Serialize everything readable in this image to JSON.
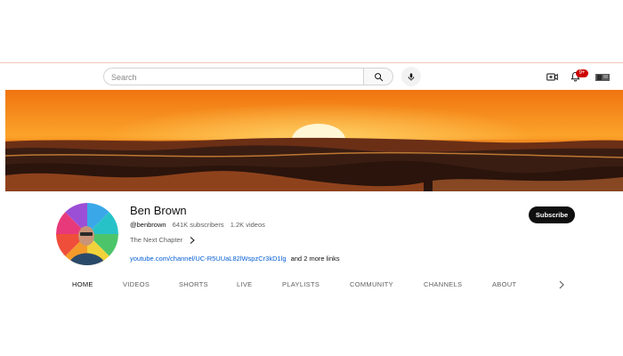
{
  "header": {
    "search": {
      "placeholder": "Search",
      "value": ""
    },
    "icons": {
      "search": "search-icon",
      "mic": "mic-icon",
      "create": "create-video-icon",
      "notifications": "bell-icon",
      "account": "account-avatar"
    },
    "notification_badge": "9+"
  },
  "banner": {
    "subject": "sunset-over-clouds",
    "colors": {
      "sky_top": "#f47a12",
      "sky_mid": "#fba52a",
      "sun": "#fff6d5",
      "clouds": "#3a1d12"
    }
  },
  "channel": {
    "name": "Ben Brown",
    "handle": "@benbrown",
    "subscribers": "641K subscribers",
    "videos": "1.2K videos",
    "description": "The Next Chapter",
    "link": "youtube.com/channel/UC-R5UUaL82lWspzCr3kD1lg",
    "more_links": "and 2 more links",
    "subscribe_label": "Subscribe"
  },
  "tabs": [
    {
      "label": "HOME",
      "active": true
    },
    {
      "label": "VIDEOS",
      "active": false
    },
    {
      "label": "SHORTS",
      "active": false
    },
    {
      "label": "LIVE",
      "active": false
    },
    {
      "label": "PLAYLISTS",
      "active": false
    },
    {
      "label": "COMMUNITY",
      "active": false
    },
    {
      "label": "CHANNELS",
      "active": false
    },
    {
      "label": "ABOUT",
      "active": false
    }
  ]
}
